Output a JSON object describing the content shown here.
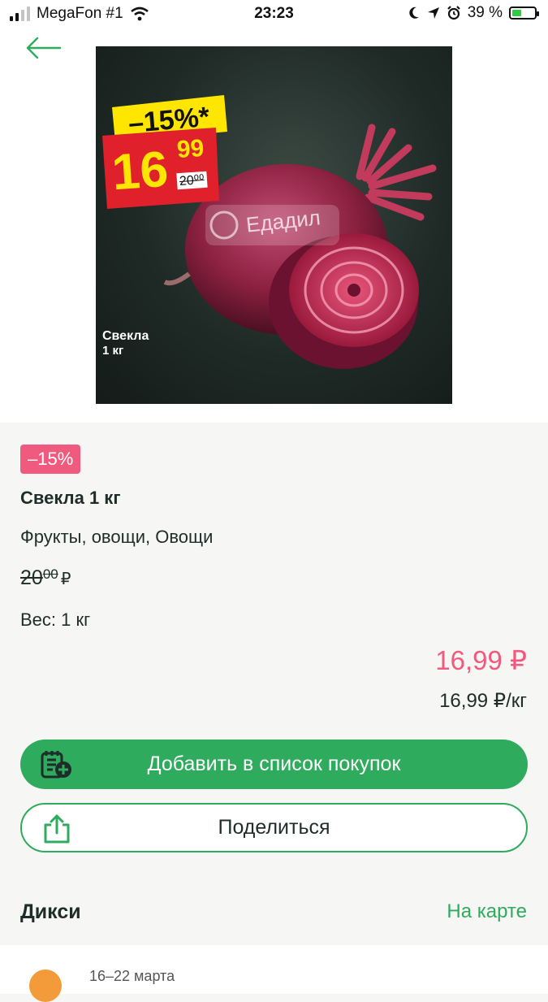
{
  "status_bar": {
    "carrier": "MegaFon #1",
    "time": "23:23",
    "battery": "39 %"
  },
  "header": {
    "back_icon": "arrow-left-icon"
  },
  "image": {
    "promo_badge": "–15%*",
    "promo_price_int": "16",
    "promo_price_dec": "99",
    "promo_old_price": "20⁰⁰",
    "watermark": "Едадил",
    "label_line1": "Свекла",
    "label_line2": "1 кг"
  },
  "product": {
    "discount_badge": "–15%",
    "name": "Свекла 1 кг",
    "category": "Фрукты, овощи, Овощи",
    "old_price_int": "20",
    "old_price_dec": "00",
    "old_price_currency": "₽",
    "weight": "Вес: 1 кг",
    "price": "16,99 ₽",
    "unit_price": "16,99 ₽/кг"
  },
  "actions": {
    "add_label": "Добавить в список покупок",
    "add_icon": "shopping-list-add-icon",
    "share_label": "Поделиться",
    "share_icon": "share-icon"
  },
  "store": {
    "name": "Дикси",
    "map_link": "На карте",
    "offer_dates": "16–22 марта"
  },
  "colors": {
    "accent_green": "#2eab5c",
    "accent_pink": "#f05a7e"
  }
}
